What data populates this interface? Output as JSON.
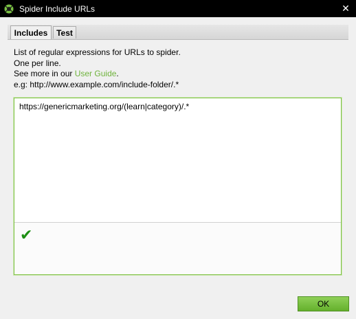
{
  "window": {
    "title": "Spider Include URLs",
    "app_icon": "spider-logo-icon",
    "close_glyph": "✕"
  },
  "tabs": [
    {
      "label": "Includes",
      "active": true
    },
    {
      "label": "Test",
      "active": false
    }
  ],
  "description": {
    "line1": "List of regular expressions for URLs to spider.",
    "line2": "One per line.",
    "line3_prefix": "See more in our ",
    "line3_link": "User Guide",
    "line3_suffix": ".",
    "line4": "e.g: http://www.example.com/include-folder/.*"
  },
  "editor": {
    "value": "https://genericmarketing.org/(learn|category)/.*"
  },
  "validation": {
    "glyph": "✔",
    "icon": "checkmark-icon",
    "color": "#1e8f14"
  },
  "buttons": {
    "ok_label": "OK"
  },
  "colors": {
    "accent": "#6fb33c",
    "ok_button": "#7cc146"
  }
}
